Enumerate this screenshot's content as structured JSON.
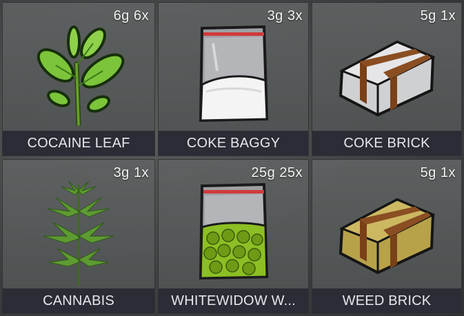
{
  "inventory": {
    "slots": [
      {
        "name": "COCAINE LEAF",
        "qty": "6g 6x",
        "icon": "coca-leaf-icon"
      },
      {
        "name": "COKE BAGGY",
        "qty": "3g 3x",
        "icon": "coke-baggy-icon"
      },
      {
        "name": "COKE BRICK",
        "qty": "5g 1x",
        "icon": "coke-brick-icon"
      },
      {
        "name": "CANNABIS",
        "qty": "3g 1x",
        "icon": "cannabis-plant-icon"
      },
      {
        "name": "WHITEWIDOW W...",
        "qty": "25g 25x",
        "icon": "weed-baggy-icon"
      },
      {
        "name": "WEED BRICK",
        "qty": "5g 1x",
        "icon": "weed-brick-icon"
      }
    ]
  },
  "colors": {
    "label_bg": "#2b2c35",
    "slot_bg": "#5a5d5c",
    "text": "#e6e7ec"
  }
}
